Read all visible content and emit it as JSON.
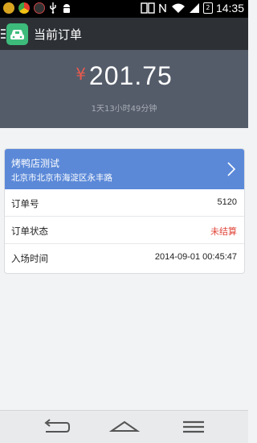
{
  "status_bar": {
    "time": "14:35",
    "battery": "2",
    "icons": [
      "notification-icon",
      "chrome-icon",
      "no-signal-icon",
      "usb-icon",
      "android-icon",
      "screen-icon",
      "nfc-icon",
      "wifi-icon",
      "signal-icon",
      "battery-icon"
    ]
  },
  "app_bar": {
    "title": "当前订单",
    "logo": "car-icon"
  },
  "summary": {
    "currency": "¥",
    "amount": "201.75",
    "duration": "1天13小时49分钟"
  },
  "order": {
    "shop_name": "烤鸭店测试",
    "address": "北京市北京市海淀区永丰路",
    "rows": [
      {
        "label": "订单号",
        "value": "5120"
      },
      {
        "label": "订单状态",
        "value": "未结算",
        "status_color": "#e0463a"
      },
      {
        "label": "入场时间",
        "value": "2014-09-01 00:45:47"
      }
    ]
  },
  "colors": {
    "app_bar": "#2d3135",
    "hero": "#545c6a",
    "card_header": "#5b89d8",
    "logo": "#3dbb7b",
    "currency": "#e65a4e"
  },
  "nav": [
    "back-icon",
    "home-icon",
    "menu-icon"
  ]
}
